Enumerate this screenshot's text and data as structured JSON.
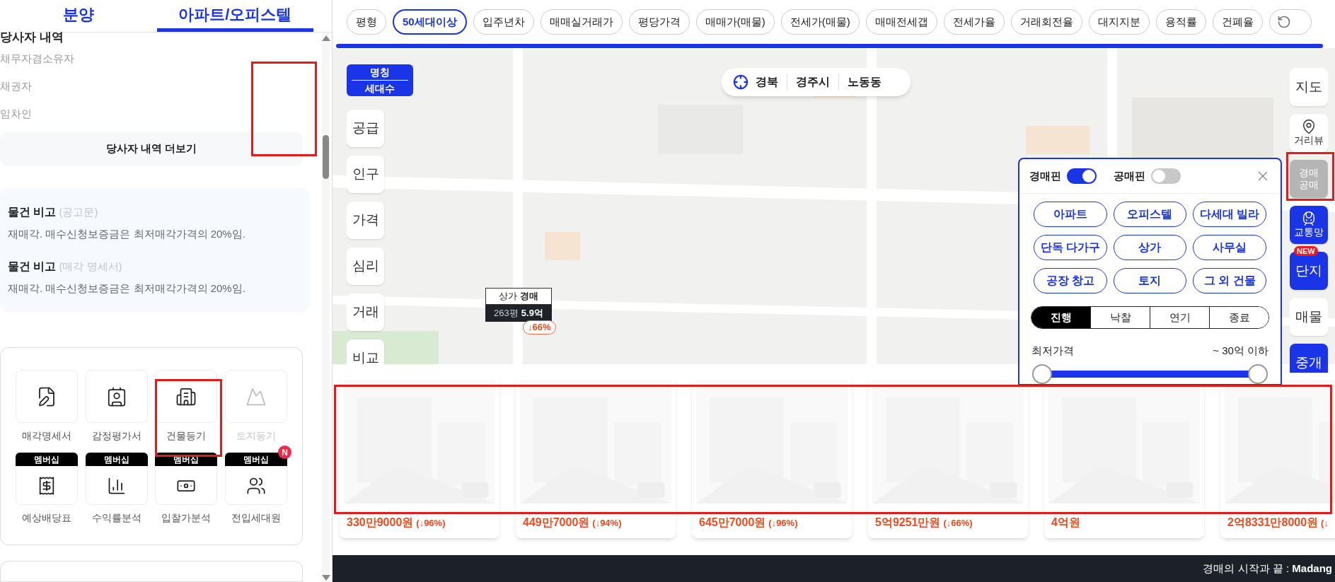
{
  "left_panel": {
    "tabs": [
      {
        "label": "분양",
        "selected": false
      },
      {
        "label": "아파트/오피스텔",
        "selected": true
      }
    ],
    "parties": {
      "title": "당사자 내역",
      "rows": [
        "채무자겸소유자",
        "채권자",
        "임차인"
      ],
      "more_button": "당사자 내역 더보기"
    },
    "notes": [
      {
        "title": "물건 비고",
        "source": "(공고문)",
        "text": "재매각. 매수신청보증금은 최저매각가격의 20%임."
      },
      {
        "title": "물건 비고",
        "source": "(매각 명세서)",
        "text": "재매각. 매수신청보증금은 최저매각가격의 20%임."
      }
    ],
    "documents": [
      {
        "label": "매각명세서",
        "disabled": false
      },
      {
        "label": "감정평가서",
        "disabled": false
      },
      {
        "label": "건물등기",
        "disabled": false
      },
      {
        "label": "토지등기",
        "disabled": true
      }
    ],
    "new_badge": "N",
    "membership_tools": [
      {
        "badge": "멤버십",
        "label": "예상배당표",
        "new": false
      },
      {
        "badge": "멤버십",
        "label": "수익률분석",
        "new": false
      },
      {
        "badge": "멤버십",
        "label": "입찰가분석",
        "new": false
      },
      {
        "badge": "멤버십",
        "label": "전입세대원",
        "new": true
      }
    ]
  },
  "filters": [
    {
      "label": "평형",
      "selected": false
    },
    {
      "label": "50세대이상",
      "selected": true
    },
    {
      "label": "입주년차",
      "selected": false
    },
    {
      "label": "매매실거래가",
      "selected": false
    },
    {
      "label": "평당가격",
      "selected": false
    },
    {
      "label": "매매가(매물)",
      "selected": false
    },
    {
      "label": "전세가(매물)",
      "selected": false
    },
    {
      "label": "매매전세갭",
      "selected": false
    },
    {
      "label": "전세가율",
      "selected": false
    },
    {
      "label": "거래회전율",
      "selected": false
    },
    {
      "label": "대지지분",
      "selected": false
    },
    {
      "label": "용적률",
      "selected": false
    },
    {
      "label": "건폐율",
      "selected": false
    }
  ],
  "map": {
    "region": [
      "경북",
      "경주시",
      "노동동"
    ],
    "layer_header": {
      "top": "명칭",
      "bottom": "세대수"
    },
    "layer_buttons": [
      "공급",
      "인구",
      "가격",
      "심리",
      "거래",
      "비교"
    ],
    "marker": {
      "type": "상가",
      "status": "경매",
      "area": "263평",
      "price": "5.9억",
      "drop": "↓66%"
    },
    "side_buttons": [
      {
        "kind": "white",
        "lines": [
          "지도"
        ]
      },
      {
        "kind": "pin",
        "lines": [
          "거리뷰"
        ]
      },
      {
        "kind": "gray",
        "lines": [
          "경매",
          "공매"
        ]
      },
      {
        "kind": "train",
        "lines": [
          "교통망"
        ]
      },
      {
        "kind": "blue",
        "badge": "NEW",
        "lines": [
          "단지"
        ]
      },
      {
        "kind": "white",
        "lines": [
          "매물"
        ]
      },
      {
        "kind": "blue",
        "lines": [
          "중개"
        ]
      }
    ]
  },
  "auction_filter": {
    "toggles": [
      {
        "label": "경매핀",
        "on": true
      },
      {
        "label": "공매핀",
        "on": false
      }
    ],
    "types": [
      "아파트",
      "오피스텔",
      "다세대 빌라",
      "단독 다가구",
      "상가",
      "사무실",
      "공장 창고",
      "토지",
      "그 외 건물"
    ],
    "statuses": [
      {
        "label": "진행",
        "selected": true
      },
      {
        "label": "낙찰",
        "selected": false
      },
      {
        "label": "연기",
        "selected": false
      },
      {
        "label": "종료",
        "selected": false
      }
    ],
    "price": {
      "label": "최저가격",
      "reading": "~ 30억 이하",
      "level": 1
    }
  },
  "listings": [
    {
      "price": "330만9000원",
      "drop": "(↓96%)"
    },
    {
      "price": "449만7000원",
      "drop": "(↓94%)"
    },
    {
      "price": "645만7000원",
      "drop": "(↓96%)"
    },
    {
      "price": "5억9251만원",
      "drop": "(↓66%)"
    },
    {
      "price": "4억원"
    },
    {
      "price": "2억8331만8000원",
      "drop": "(↓"
    }
  ],
  "footer": {
    "text": "경매의 시작과 끝 : **Madang**"
  }
}
